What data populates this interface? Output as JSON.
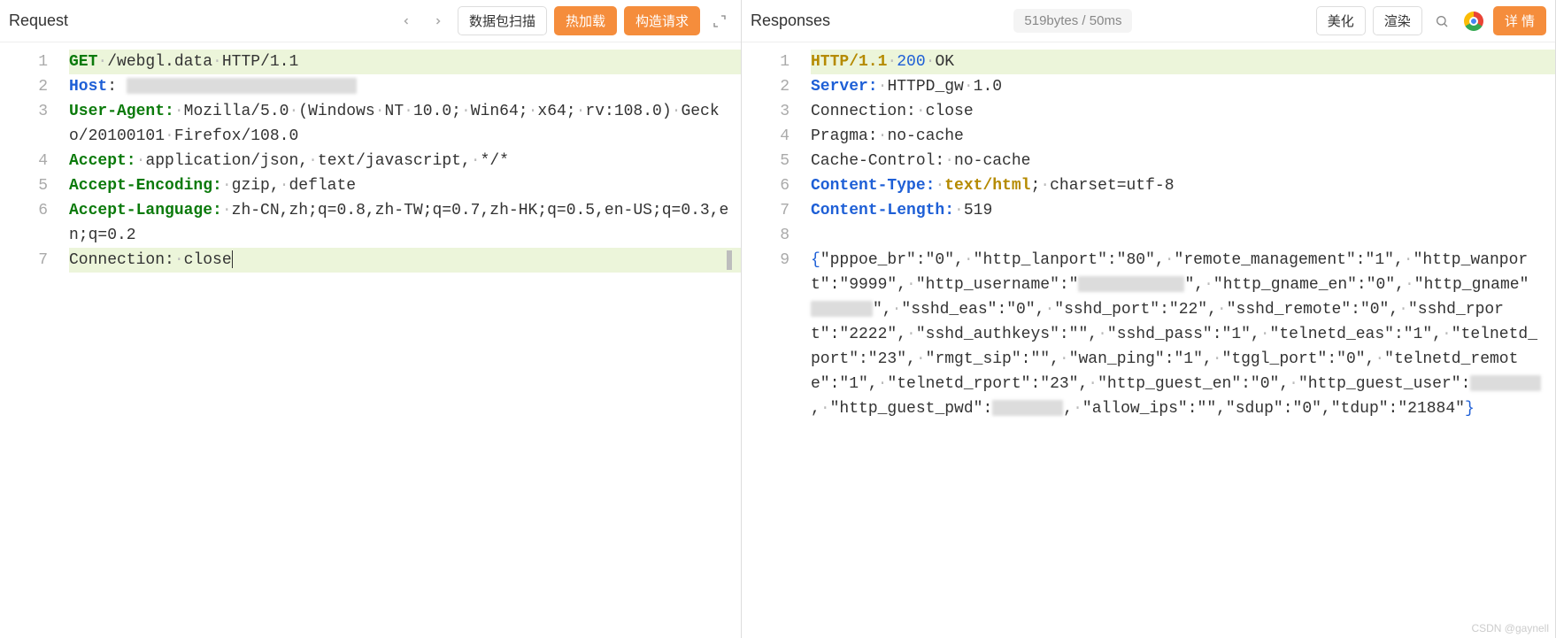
{
  "request": {
    "title": "Request",
    "buttons": {
      "scan": "数据包扫描",
      "hotload": "热加载",
      "build": "构造请求"
    },
    "lines": [
      {
        "n": "1",
        "segments": [
          {
            "t": "GET",
            "cls": "tok-method"
          },
          {
            "t": "·",
            "cls": "dot"
          },
          {
            "t": "/webgl.data"
          },
          {
            "t": "·",
            "cls": "dot"
          },
          {
            "t": "HTTP/1.1"
          }
        ],
        "hl": true
      },
      {
        "n": "2",
        "segments": [
          {
            "t": "Host",
            "cls": "tok-header"
          },
          {
            "t": ": "
          },
          {
            "censor": 260
          }
        ]
      },
      {
        "n": "3",
        "segments": [
          {
            "t": "User-Agent:",
            "cls": "tok-green-kw"
          },
          {
            "t": "·",
            "cls": "dot"
          },
          {
            "t": "Mozilla/5.0"
          },
          {
            "t": "·",
            "cls": "dot"
          },
          {
            "t": "(Windows"
          },
          {
            "t": "·",
            "cls": "dot"
          },
          {
            "t": "NT"
          },
          {
            "t": "·",
            "cls": "dot"
          },
          {
            "t": "10.0;"
          },
          {
            "t": "·",
            "cls": "dot"
          },
          {
            "t": "Win64;"
          },
          {
            "t": "·",
            "cls": "dot"
          },
          {
            "t": "x64;"
          },
          {
            "t": "·",
            "cls": "dot"
          },
          {
            "t": "rv:108.0)"
          },
          {
            "t": "·",
            "cls": "dot"
          },
          {
            "t": "Gecko/20100101"
          },
          {
            "t": "·",
            "cls": "dot"
          },
          {
            "t": "Firefox/108.0"
          }
        ]
      },
      {
        "n": "4",
        "segments": [
          {
            "t": "Accept:",
            "cls": "tok-green-kw"
          },
          {
            "t": "·",
            "cls": "dot"
          },
          {
            "t": "application/json,"
          },
          {
            "t": "·",
            "cls": "dot"
          },
          {
            "t": "text/javascript,"
          },
          {
            "t": "·",
            "cls": "dot"
          },
          {
            "t": "*/*"
          }
        ]
      },
      {
        "n": "5",
        "segments": [
          {
            "t": "Accept-Encoding:",
            "cls": "tok-green-kw"
          },
          {
            "t": "·",
            "cls": "dot"
          },
          {
            "t": "gzip,"
          },
          {
            "t": "·",
            "cls": "dot"
          },
          {
            "t": "deflate"
          }
        ]
      },
      {
        "n": "6",
        "segments": [
          {
            "t": "Accept-Language:",
            "cls": "tok-green-kw"
          },
          {
            "t": "·",
            "cls": "dot"
          },
          {
            "t": "zh-CN,zh;q=0.8,zh-TW;q=0.7,zh-HK;q=0.5,en-US;q=0.3,en;q=0.2"
          }
        ]
      },
      {
        "n": "7",
        "segments": [
          {
            "t": "Connection:"
          },
          {
            "t": "·",
            "cls": "dot"
          },
          {
            "t": "close"
          }
        ],
        "hl": true,
        "cursor": true,
        "edgeMark": true
      }
    ]
  },
  "response": {
    "title": "Responses",
    "status": "519bytes / 50ms",
    "buttons": {
      "beautify": "美化",
      "render": "渲染",
      "detail": "详 情"
    },
    "lines": [
      {
        "n": "1",
        "segments": [
          {
            "t": "HTTP/1.1",
            "cls": "tok-gold"
          },
          {
            "t": "·",
            "cls": "dot"
          },
          {
            "t": "200",
            "cls": "tok-num"
          },
          {
            "t": "·",
            "cls": "dot"
          },
          {
            "t": "OK"
          }
        ],
        "hl": true
      },
      {
        "n": "2",
        "segments": [
          {
            "t": "Server:",
            "cls": "tok-header"
          },
          {
            "t": "·",
            "cls": "dot"
          },
          {
            "t": "HTTPD_gw"
          },
          {
            "t": "·",
            "cls": "dot"
          },
          {
            "t": "1.0"
          }
        ]
      },
      {
        "n": "3",
        "segments": [
          {
            "t": "Connection:"
          },
          {
            "t": "·",
            "cls": "dot"
          },
          {
            "t": "close"
          }
        ]
      },
      {
        "n": "4",
        "segments": [
          {
            "t": "Pragma:"
          },
          {
            "t": "·",
            "cls": "dot"
          },
          {
            "t": "no-cache"
          }
        ]
      },
      {
        "n": "5",
        "segments": [
          {
            "t": "Cache-Control:"
          },
          {
            "t": "·",
            "cls": "dot"
          },
          {
            "t": "no-cache"
          }
        ]
      },
      {
        "n": "6",
        "segments": [
          {
            "t": "Content-Type:",
            "cls": "tok-header"
          },
          {
            "t": "·",
            "cls": "dot"
          },
          {
            "t": "text/html",
            "cls": "tok-gold"
          },
          {
            "t": ";"
          },
          {
            "t": "·",
            "cls": "dot"
          },
          {
            "t": "charset=utf-8"
          }
        ]
      },
      {
        "n": "7",
        "segments": [
          {
            "t": "Content-Length:",
            "cls": "tok-header"
          },
          {
            "t": "·",
            "cls": "dot"
          },
          {
            "t": "519"
          }
        ]
      },
      {
        "n": "8",
        "segments": []
      },
      {
        "n": "9",
        "segments": [
          {
            "t": "{",
            "cls": "tok-brace"
          },
          {
            "t": "\"pppoe_br\":\"0\","
          },
          {
            "t": "·",
            "cls": "dot"
          },
          {
            "t": "\"http_lanport\":\"80\","
          },
          {
            "t": "·",
            "cls": "dot"
          },
          {
            "t": "\"remote_management\":\"1\","
          },
          {
            "t": "·",
            "cls": "dot"
          },
          {
            "t": "\"http_wanport\":\"9999\","
          },
          {
            "t": "·",
            "cls": "dot"
          },
          {
            "t": "\"http_username\":\""
          },
          {
            "censor": 120
          },
          {
            "t": "\","
          },
          {
            "t": "·",
            "cls": "dot"
          },
          {
            "t": "\"http_gname_en\":\"0\","
          },
          {
            "t": "·",
            "cls": "dot"
          },
          {
            "t": "\"http_gname\""
          },
          {
            "censor": 70
          },
          {
            "t": "\","
          },
          {
            "t": "·",
            "cls": "dot"
          },
          {
            "t": "\"sshd_eas\":\"0\","
          },
          {
            "t": "·",
            "cls": "dot"
          },
          {
            "t": "\"sshd_port\":\"22\","
          },
          {
            "t": "·",
            "cls": "dot"
          },
          {
            "t": "\"sshd_remote\":\"0\","
          },
          {
            "t": "·",
            "cls": "dot"
          },
          {
            "t": "\"sshd_rport\":\"2222\","
          },
          {
            "t": "·",
            "cls": "dot"
          },
          {
            "t": "\"sshd_authkeys\":\"\","
          },
          {
            "t": "·",
            "cls": "dot"
          },
          {
            "t": "\"sshd_pass\":\"1\","
          },
          {
            "t": "·",
            "cls": "dot"
          },
          {
            "t": "\"telnetd_eas\":\"1\","
          },
          {
            "t": "·",
            "cls": "dot"
          },
          {
            "t": "\"telnetd_port\":\"23\","
          },
          {
            "t": "·",
            "cls": "dot"
          },
          {
            "t": "\"rmgt_sip\":\"\","
          },
          {
            "t": "·",
            "cls": "dot"
          },
          {
            "t": "\"wan_ping\":\"1\","
          },
          {
            "t": "·",
            "cls": "dot"
          },
          {
            "t": "\"tggl_port\":\"0\","
          },
          {
            "t": "·",
            "cls": "dot"
          },
          {
            "t": "\"telnetd_remote\":\"1\","
          },
          {
            "t": "·",
            "cls": "dot"
          },
          {
            "t": "\"telnetd_rport\":\"23\","
          },
          {
            "t": "·",
            "cls": "dot"
          },
          {
            "t": "\"http_guest_en\":\"0\","
          },
          {
            "t": "·",
            "cls": "dot"
          },
          {
            "t": "\"http_guest_user\":"
          },
          {
            "censor": 80
          },
          {
            "t": ","
          },
          {
            "t": "·",
            "cls": "dot"
          },
          {
            "t": "\"http_guest_pwd\":"
          },
          {
            "censor": 80
          },
          {
            "t": ","
          },
          {
            "t": "·",
            "cls": "dot"
          },
          {
            "t": "\"allow_ips\":\"\",\"sdup\":\"0\",\"tdup\":\"21884\""
          },
          {
            "t": "}",
            "cls": "tok-brace"
          }
        ]
      }
    ]
  },
  "watermark": "CSDN @gaynell"
}
